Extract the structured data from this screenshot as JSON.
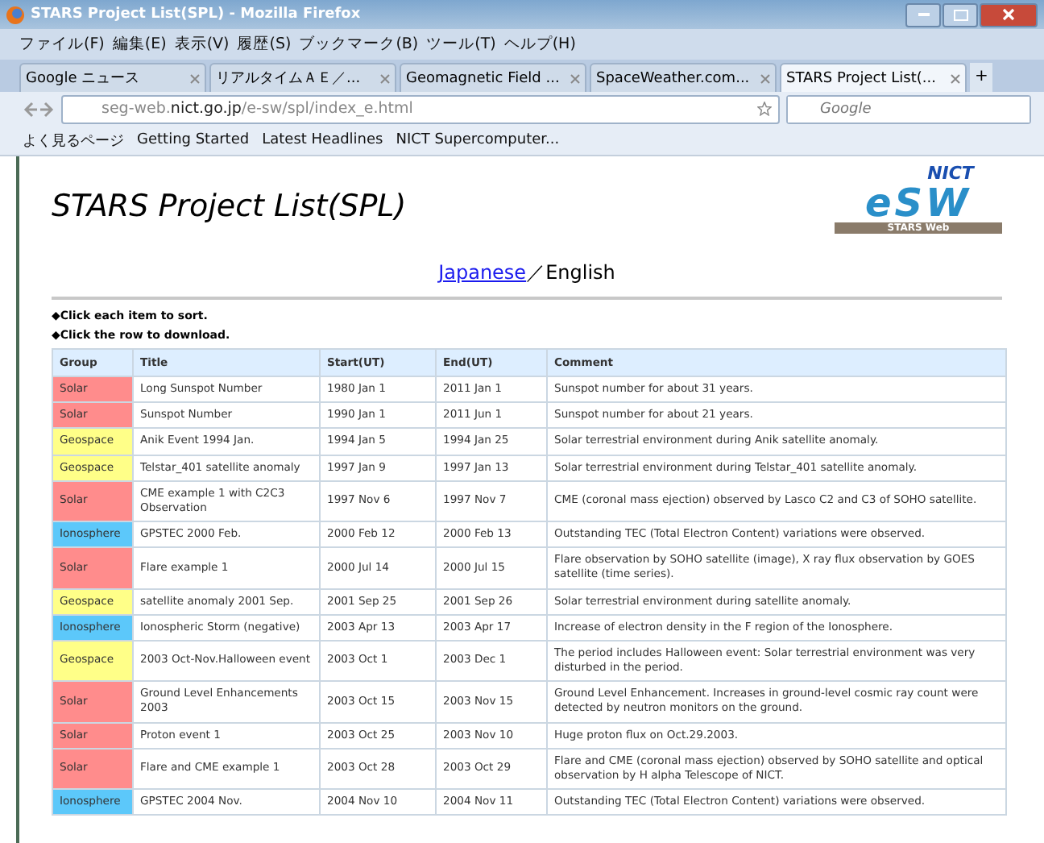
{
  "window": {
    "title": "STARS Project List(SPL) - Mozilla Firefox"
  },
  "menu": [
    "ファイル(F)",
    "編集(E)",
    "表示(V)",
    "履歴(S)",
    "ブックマーク(B)",
    "ツール(T)",
    "ヘルプ(H)"
  ],
  "tabs": [
    {
      "label": "Google ニュース",
      "selected": false
    },
    {
      "label": "リアルタイムＡＥ／...",
      "selected": false
    },
    {
      "label": "Geomagnetic Field ...",
      "selected": false
    },
    {
      "label": "SpaceWeather.com...",
      "selected": false
    },
    {
      "label": "STARS Project List(...",
      "selected": true
    }
  ],
  "new_tab": "+",
  "address": {
    "host_pre": "seg-web.",
    "host": "nict.go.jp",
    "path": "/e-sw/spl/index_e.html"
  },
  "search": {
    "placeholder": "Google"
  },
  "bookmarks": [
    "よく見るページ",
    "Getting Started",
    "Latest Headlines",
    "NICT Supercomputer..."
  ],
  "page": {
    "title": "STARS Project List(SPL)",
    "logo": {
      "top": "NICT",
      "main": "eSW",
      "sub": "STARS  Web"
    },
    "language_link": "Japanese",
    "language_separator": "／",
    "language_current": "English",
    "notes": [
      "◆Click each item to sort.",
      "◆Click the row to download."
    ]
  },
  "table": {
    "columns": [
      "Group",
      "Title",
      "Start(UT)",
      "End(UT)",
      "Comment"
    ],
    "rows": [
      {
        "group": "Solar",
        "color": "#ff8c8c",
        "title": "Long Sunspot Number",
        "start": "1980 Jan 1",
        "end": "2011  Jan 1",
        "comment": "Sunspot number for about 31  years."
      },
      {
        "group": "Solar",
        "color": "#ff8c8c",
        "title": "Sunspot Number",
        "start": "1990 Jan 1",
        "end": "2011  Jun 1",
        "comment": "Sunspot number for about 21  years."
      },
      {
        "group": "Geospace",
        "color": "#ffff88",
        "title": "Anik Event 1994  Jan.",
        "start": "1994  Jan 5",
        "end": "1994  Jan 25",
        "comment": "Solar terrestrial environment during Anik satellite anomaly."
      },
      {
        "group": "Geospace",
        "color": "#ffff88",
        "title": "Telstar_401  satellite anomaly",
        "start": "1997  Jan 9",
        "end": "1997  Jan 13",
        "comment": "Solar terrestrial environment during Telstar_401  satellite anomaly."
      },
      {
        "group": "Solar",
        "color": "#ff8c8c",
        "title": "CME example 1  with C2C3 Observation",
        "start": "1997 Nov 6",
        "end": "1997 Nov 7",
        "comment": "CME (coronal mass ejection) observed by Lasco C2 and C3 of SOHO satellite."
      },
      {
        "group": "Ionosphere",
        "color": "#5cc8fa",
        "title": "GPSTEC 2000 Feb.",
        "start": "2000 Feb 12",
        "end": "2000 Feb 13",
        "comment": "Outstanding TEC (Total Electron Content) variations were observed."
      },
      {
        "group": "Solar",
        "color": "#ff8c8c",
        "title": "Flare example 1",
        "start": "2000 Jul 14",
        "end": "2000 Jul 15",
        "comment": "Flare observation by SOHO satellite (image), X ray flux observation by GOES satellite (time series)."
      },
      {
        "group": "Geospace",
        "color": "#ffff88",
        "title": "satellite anomaly 2001  Sep.",
        "start": "2001  Sep 25",
        "end": "2001  Sep 26",
        "comment": "Solar terrestrial environment during satellite anomaly."
      },
      {
        "group": "Ionosphere",
        "color": "#5cc8fa",
        "title": "Ionospheric Storm (negative)",
        "start": "2003 Apr 13",
        "end": "2003 Apr 17",
        "comment": "Increase of electron density in the F region of the Ionosphere."
      },
      {
        "group": "Geospace",
        "color": "#ffff88",
        "title": "2003 Oct-Nov.Halloween event",
        "start": "2003 Oct 1",
        "end": "2003 Dec 1",
        "comment": "The period includes Halloween event: Solar terrestrial environment was very disturbed in the period."
      },
      {
        "group": "Solar",
        "color": "#ff8c8c",
        "title": "Ground Level Enhancements 2003",
        "start": "2003 Oct 15",
        "end": "2003 Nov 15",
        "comment": "Ground  Level  Enhancement. Increases in ground-level cosmic ray count were detected by neutron monitors on the ground."
      },
      {
        "group": "Solar",
        "color": "#ff8c8c",
        "title": "Proton event 1",
        "start": "2003 Oct 25",
        "end": "2003 Nov 10",
        "comment": "Huge proton flux on Oct.29.2003."
      },
      {
        "group": "Solar",
        "color": "#ff8c8c",
        "title": "Flare and CME example 1",
        "start": "2003 Oct 28",
        "end": "2003 Oct 29",
        "comment": "Flare and CME (coronal mass ejection) observed by SOHO satellite and optical observation by H alpha Telescope of NICT."
      },
      {
        "group": "Ionosphere",
        "color": "#5cc8fa",
        "title": "GPSTEC 2004 Nov.",
        "start": "2004 Nov 10",
        "end": "2004 Nov 11",
        "comment": "Outstanding TEC (Total Electron Content) variations were observed."
      }
    ]
  }
}
